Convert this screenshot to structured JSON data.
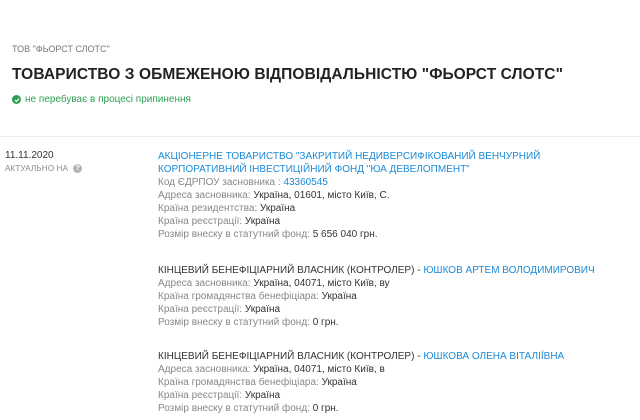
{
  "breadcrumb": "ТОВ \"ФЬОРСТ СЛОТС\"",
  "title": "ТОВАРИСТВО З ОБМЕЖЕНОЮ ВІДПОВІДАЛЬНІСТЮ \"ФЬОРСТ СЛОТС\"",
  "status": "не перебуває в процесі припинення",
  "date": "11.11.2020",
  "actual_label": "АКТУАЛЬНО НА",
  "help_glyph": "?",
  "entries": [
    {
      "title": "АКЦІОНЕРНЕ ТОВАРИСТВО \"ЗАКРИТИЙ НЕДИВЕРСИФІКОВАНИЙ ВЕНЧУРНИЙ КОРПОРАТИВНИЙ ІНВЕСТИЦІЙНИЙ ФОНД \"ЮА ДЕВЕЛОПМЕНТ\"",
      "code_label": "Код ЄДРПОУ засновника :",
      "code_value": "43360545",
      "address_label": "Адреса засновника:",
      "address_value": "Україна, 01601, місто Київ, С.",
      "residence_label": "Країна резидентства:",
      "residence_value": "Україна",
      "registration_label": "Країна реєстрації:",
      "registration_value": "Україна",
      "capital_label": "Розмір внеску в статутний фонд:",
      "capital_value": "5 656 040 грн."
    },
    {
      "role": "КІНЦЕВИЙ БЕНЕФІЦІАРНИЙ ВЛАСНИК (КОНТРОЛЕР) -",
      "name": "ЮШКОВ АРТЕМ ВОЛОДИМИРОВИЧ",
      "address_label": "Адреса засновника:",
      "address_value": "Україна, 04071, місто Київ, ву",
      "citizenship_label": "Країна громадянства бенефіціара:",
      "citizenship_value": "Україна",
      "registration_label": "Країна реєстрації:",
      "registration_value": "Україна",
      "capital_label": "Розмір внеску в статутний фонд:",
      "capital_value": "0 грн."
    },
    {
      "role": "КІНЦЕВИЙ БЕНЕФІЦІАРНИЙ ВЛАСНИК (КОНТРОЛЕР) -",
      "name": "ЮШКОВА ОЛЕНА ВІТАЛІЇВНА",
      "address_label": "Адреса засновника:",
      "address_value": "Україна, 04071, місто Київ, в",
      "citizenship_label": "Країна громадянства бенефіціара:",
      "citizenship_value": "Україна",
      "registration_label": "Країна реєстрації:",
      "registration_value": "Україна",
      "capital_label": "Розмір внеску в статутний фонд:",
      "capital_value": "0 грн."
    }
  ]
}
